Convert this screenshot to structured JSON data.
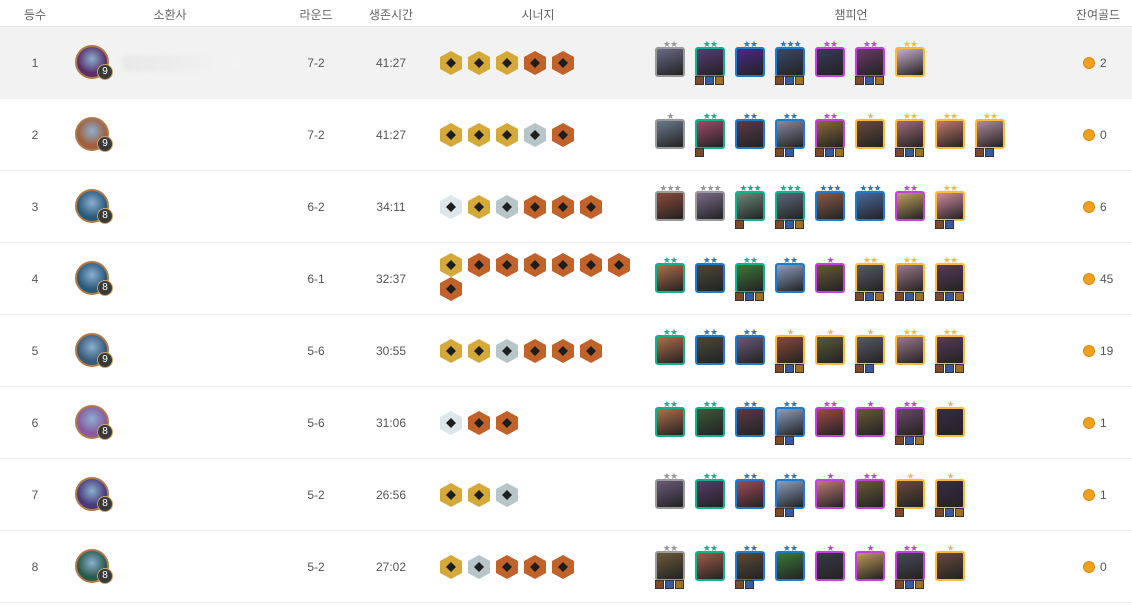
{
  "headers": {
    "rank": "등수",
    "summoner": "소환사",
    "round": "라운드",
    "survival_time": "생존시간",
    "synergy": "시너지",
    "champion": "챔피언",
    "remaining_gold": "잔여골드"
  },
  "colors": {
    "cost1": "#999999",
    "cost2": "#11b288",
    "cost3": "#207ac7",
    "cost4": "#c440da",
    "cost5": "#ffb93b",
    "trait_gold": "#d4a93a",
    "trait_bronze": "#c0622a",
    "trait_silver": "#b7c4c8",
    "coin": "#f0a020"
  },
  "rows": [
    {
      "rank": "1",
      "level": "9",
      "round": "7-2",
      "time": "41:27",
      "gold": "2",
      "avatar_color": "#5b2f6a",
      "traits": [
        "gold",
        "gold",
        "gold",
        "bronze",
        "bronze"
      ],
      "champions": [
        {
          "cost": 1,
          "stars": 2,
          "items": 0,
          "bg": "#6a6a8a"
        },
        {
          "cost": 2,
          "stars": 2,
          "items": 3,
          "bg": "#5a3a7a"
        },
        {
          "cost": 3,
          "stars": 2,
          "items": 0,
          "bg": "#4a2a8a"
        },
        {
          "cost": 3,
          "stars": 3,
          "items": 3,
          "bg": "#3a4a6a"
        },
        {
          "cost": 4,
          "stars": 2,
          "items": 0,
          "bg": "#3a3a5a"
        },
        {
          "cost": 4,
          "stars": 2,
          "items": 3,
          "bg": "#6a3a6a"
        },
        {
          "cost": 5,
          "stars": 2,
          "items": 0,
          "bg": "#c8b0c8"
        }
      ]
    },
    {
      "rank": "2",
      "level": "9",
      "round": "7-2",
      "time": "41:27",
      "gold": "0",
      "avatar_color": "#a06040",
      "traits": [
        "gold",
        "gold",
        "gold",
        "silver",
        "bronze"
      ],
      "champions": [
        {
          "cost": 1,
          "stars": 1,
          "items": 0,
          "bg": "#6a7a8a"
        },
        {
          "cost": 2,
          "stars": 2,
          "items": 1,
          "bg": "#a04a6a"
        },
        {
          "cost": 3,
          "stars": 2,
          "items": 0,
          "bg": "#5a3a4a"
        },
        {
          "cost": 3,
          "stars": 2,
          "items": 2,
          "bg": "#8a8aa0"
        },
        {
          "cost": 4,
          "stars": 2,
          "items": 3,
          "bg": "#8a6a3a"
        },
        {
          "cost": 5,
          "stars": 1,
          "items": 0,
          "bg": "#6a4a3a"
        },
        {
          "cost": 5,
          "stars": 2,
          "items": 3,
          "bg": "#a06a7a"
        },
        {
          "cost": 5,
          "stars": 2,
          "items": 0,
          "bg": "#c07a6a"
        },
        {
          "cost": 5,
          "stars": 2,
          "items": 2,
          "bg": "#b08a9a"
        }
      ]
    },
    {
      "rank": "3",
      "level": "8",
      "round": "6-2",
      "time": "34:11",
      "gold": "6",
      "avatar_color": "#2a5a7a",
      "traits": [
        "white",
        "gold",
        "silver",
        "bronze",
        "bronze",
        "bronze"
      ],
      "champions": [
        {
          "cost": 1,
          "stars": 3,
          "items": 0,
          "bg": "#8a4a3a"
        },
        {
          "cost": 1,
          "stars": 3,
          "items": 0,
          "bg": "#7a6a8a"
        },
        {
          "cost": 2,
          "stars": 3,
          "items": 1,
          "bg": "#6a8a7a"
        },
        {
          "cost": 2,
          "stars": 3,
          "items": 3,
          "bg": "#5a6a7a"
        },
        {
          "cost": 3,
          "stars": 3,
          "items": 0,
          "bg": "#8a5a4a"
        },
        {
          "cost": 3,
          "stars": 3,
          "items": 0,
          "bg": "#4a6aa0"
        },
        {
          "cost": 4,
          "stars": 2,
          "items": 0,
          "bg": "#c0a060"
        },
        {
          "cost": 5,
          "stars": 2,
          "items": 2,
          "bg": "#d08aa0"
        }
      ]
    },
    {
      "rank": "4",
      "level": "8",
      "round": "6-1",
      "time": "32:37",
      "gold": "45",
      "avatar_color": "#2a5a7a",
      "traits": [
        "gold",
        "bronze",
        "bronze",
        "bronze",
        "bronze",
        "bronze",
        "bronze",
        "bronze"
      ],
      "champions": [
        {
          "cost": 2,
          "stars": 2,
          "items": 0,
          "bg": "#b0704a"
        },
        {
          "cost": 3,
          "stars": 2,
          "items": 0,
          "bg": "#4a4a3a"
        },
        {
          "cost": 2,
          "stars": 2,
          "items": 3,
          "bg": "#3a7a3a"
        },
        {
          "cost": 3,
          "stars": 2,
          "items": 0,
          "bg": "#8aa0c0"
        },
        {
          "cost": 4,
          "stars": 1,
          "items": 0,
          "bg": "#6a5a3a"
        },
        {
          "cost": 5,
          "stars": 2,
          "items": 3,
          "bg": "#5a5a6a"
        },
        {
          "cost": 5,
          "stars": 2,
          "items": 3,
          "bg": "#a07a8a"
        },
        {
          "cost": 5,
          "stars": 2,
          "items": 3,
          "bg": "#5a3a5a"
        }
      ]
    },
    {
      "rank": "5",
      "level": "9",
      "round": "5-6",
      "time": "30:55",
      "gold": "19",
      "avatar_color": "#3a5a7a",
      "traits": [
        "gold",
        "gold",
        "silver",
        "bronze",
        "bronze",
        "bronze"
      ],
      "champions": [
        {
          "cost": 2,
          "stars": 2,
          "items": 0,
          "bg": "#b0704a"
        },
        {
          "cost": 3,
          "stars": 2,
          "items": 0,
          "bg": "#4a4a3a"
        },
        {
          "cost": 3,
          "stars": 2,
          "items": 0,
          "bg": "#6a5a7a"
        },
        {
          "cost": 5,
          "stars": 1,
          "items": 3,
          "bg": "#8a4a3a"
        },
        {
          "cost": 5,
          "stars": 1,
          "items": 0,
          "bg": "#5a5a3a"
        },
        {
          "cost": 5,
          "stars": 1,
          "items": 2,
          "bg": "#5a5a6a"
        },
        {
          "cost": 5,
          "stars": 2,
          "items": 0,
          "bg": "#a07a8a"
        },
        {
          "cost": 5,
          "stars": 2,
          "items": 3,
          "bg": "#5a3a5a"
        }
      ]
    },
    {
      "rank": "6",
      "level": "8",
      "round": "5-6",
      "time": "31:06",
      "gold": "1",
      "avatar_color": "#8a5aa0",
      "traits": [
        "white",
        "bronze",
        "bronze"
      ],
      "champions": [
        {
          "cost": 2,
          "stars": 2,
          "items": 0,
          "bg": "#b0704a"
        },
        {
          "cost": 2,
          "stars": 2,
          "items": 0,
          "bg": "#3a5a3a"
        },
        {
          "cost": 3,
          "stars": 2,
          "items": 0,
          "bg": "#5a3a4a"
        },
        {
          "cost": 3,
          "stars": 2,
          "items": 2,
          "bg": "#8aa0c0"
        },
        {
          "cost": 4,
          "stars": 2,
          "items": 0,
          "bg": "#a04a4a"
        },
        {
          "cost": 4,
          "stars": 1,
          "items": 0,
          "bg": "#6a5a3a"
        },
        {
          "cost": 4,
          "stars": 2,
          "items": 3,
          "bg": "#6a4a6a"
        },
        {
          "cost": 5,
          "stars": 1,
          "items": 0,
          "bg": "#3a2a4a"
        }
      ]
    },
    {
      "rank": "7",
      "level": "8",
      "round": "5-2",
      "time": "26:56",
      "gold": "1",
      "avatar_color": "#4a3a7a",
      "traits": [
        "gold",
        "gold",
        "silver"
      ],
      "champions": [
        {
          "cost": 1,
          "stars": 2,
          "items": 0,
          "bg": "#6a5a7a"
        },
        {
          "cost": 2,
          "stars": 2,
          "items": 0,
          "bg": "#5a3a6a"
        },
        {
          "cost": 3,
          "stars": 2,
          "items": 0,
          "bg": "#a04a5a"
        },
        {
          "cost": 3,
          "stars": 2,
          "items": 2,
          "bg": "#8aa0c0"
        },
        {
          "cost": 4,
          "stars": 1,
          "items": 0,
          "bg": "#c07a7a"
        },
        {
          "cost": 4,
          "stars": 2,
          "items": 0,
          "bg": "#6a5a3a"
        },
        {
          "cost": 5,
          "stars": 1,
          "items": 1,
          "bg": "#6a4a3a"
        },
        {
          "cost": 5,
          "stars": 1,
          "items": 3,
          "bg": "#3a2a4a"
        }
      ]
    },
    {
      "rank": "8",
      "level": "8",
      "round": "5-2",
      "time": "27:02",
      "gold": "0",
      "avatar_color": "#2a5a4a",
      "traits": [
        "gold",
        "silver",
        "bronze",
        "bronze",
        "bronze"
      ],
      "champions": [
        {
          "cost": 1,
          "stars": 2,
          "items": 3,
          "bg": "#6a5a3a"
        },
        {
          "cost": 2,
          "stars": 2,
          "items": 0,
          "bg": "#a05a4a"
        },
        {
          "cost": 3,
          "stars": 2,
          "items": 2,
          "bg": "#5a4a3a"
        },
        {
          "cost": 3,
          "stars": 2,
          "items": 0,
          "bg": "#3a7a3a"
        },
        {
          "cost": 4,
          "stars": 1,
          "items": 0,
          "bg": "#3a3a4a"
        },
        {
          "cost": 4,
          "stars": 1,
          "items": 0,
          "bg": "#c09a5a"
        },
        {
          "cost": 4,
          "stars": 2,
          "items": 3,
          "bg": "#4a4a5a"
        },
        {
          "cost": 5,
          "stars": 1,
          "items": 0,
          "bg": "#6a4a3a"
        }
      ]
    }
  ]
}
